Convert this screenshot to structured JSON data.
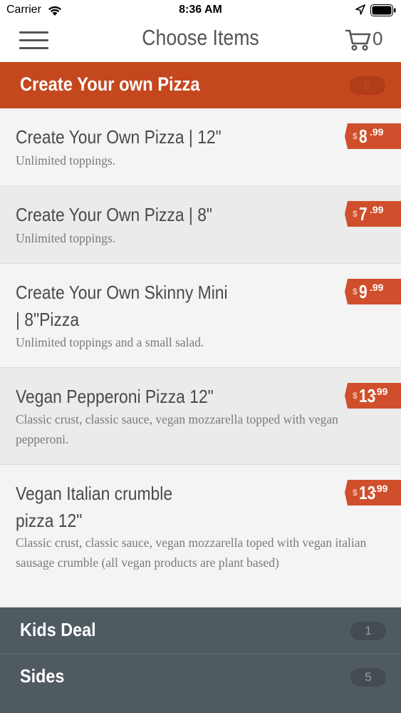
{
  "status_bar": {
    "carrier": "Carrier",
    "time": "8:36 AM"
  },
  "nav": {
    "title": "Choose Items",
    "cart_count": "0"
  },
  "active_category": {
    "title": "Create Your own Pizza",
    "count": "5"
  },
  "items": [
    {
      "name": "Create Your Own Pizza | 12\"",
      "description": "Unlimited toppings.",
      "price_dollar": "$",
      "price_whole": "8",
      "price_cents": ".99"
    },
    {
      "name": "Create Your Own Pizza | 8\"",
      "description": "Unlimited toppings.",
      "price_dollar": "$",
      "price_whole": "7",
      "price_cents": ".99"
    },
    {
      "name": "Create Your Own Skinny Mini | 8\"Pizza",
      "description": "Unlimited toppings and a small salad.",
      "price_dollar": "$",
      "price_whole": "9",
      "price_cents": ".99"
    },
    {
      "name": "Vegan Pepperoni Pizza 12\"",
      "description": "Classic crust, classic sauce, vegan mozzarella topped with vegan pepperoni.",
      "price_dollar": "$",
      "price_whole": "13",
      "price_cents": ".99"
    },
    {
      "name": "Vegan Italian crumble pizza 12\"",
      "description": "Classic crust, classic sauce, vegan mozzarella toped with vegan italian sausage crumble (all vegan products are plant based)",
      "price_dollar": "$",
      "price_whole": "13",
      "price_cents": ".99"
    }
  ],
  "other_categories": [
    {
      "title": "Kids Deal",
      "count": "1"
    },
    {
      "title": "Sides",
      "count": "5"
    }
  ],
  "colors": {
    "accent": "#c4471e",
    "price_tag": "#cf4f2c",
    "collapsed_category": "#4f5a61"
  },
  "icons": {
    "menu": "hamburger-menu-icon",
    "cart": "shopping-cart-icon",
    "wifi": "wifi-icon",
    "location": "location-arrow-icon",
    "battery": "battery-icon"
  }
}
